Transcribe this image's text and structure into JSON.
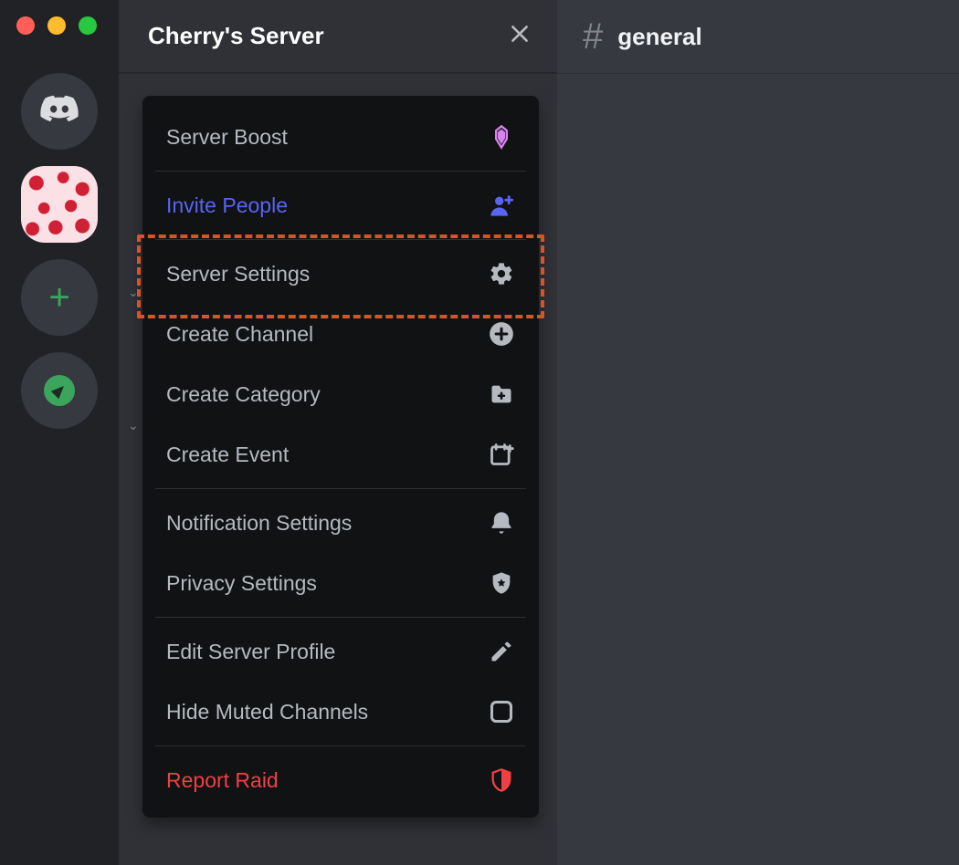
{
  "header": {
    "server_title": "Cherry's Server",
    "channel_name": "general"
  },
  "dropdown": {
    "items": [
      {
        "label": "Server Boost",
        "icon": "boost-icon",
        "color": "default"
      },
      {
        "label": "Invite People",
        "icon": "invite-icon",
        "color": "blue"
      },
      {
        "label": "Server Settings",
        "icon": "gear-icon",
        "color": "default",
        "highlighted": true
      },
      {
        "label": "Create Channel",
        "icon": "plus-circle-icon",
        "color": "default"
      },
      {
        "label": "Create Category",
        "icon": "folder-plus-icon",
        "color": "default"
      },
      {
        "label": "Create Event",
        "icon": "calendar-plus-icon",
        "color": "default"
      },
      {
        "label": "Notification Settings",
        "icon": "bell-icon",
        "color": "default"
      },
      {
        "label": "Privacy Settings",
        "icon": "shield-star-icon",
        "color": "default"
      },
      {
        "label": "Edit Server Profile",
        "icon": "pencil-icon",
        "color": "default"
      },
      {
        "label": "Hide Muted Channels",
        "icon": "checkbox-icon",
        "color": "default"
      },
      {
        "label": "Report Raid",
        "icon": "shield-alert-icon",
        "color": "red"
      }
    ],
    "dividers_after_index": [
      0,
      1,
      5,
      7,
      9
    ]
  },
  "colors": {
    "blurple": "#5865f2",
    "danger": "#f23f43",
    "boost_pink": "#d782f0",
    "highlight": "#d9522b"
  }
}
